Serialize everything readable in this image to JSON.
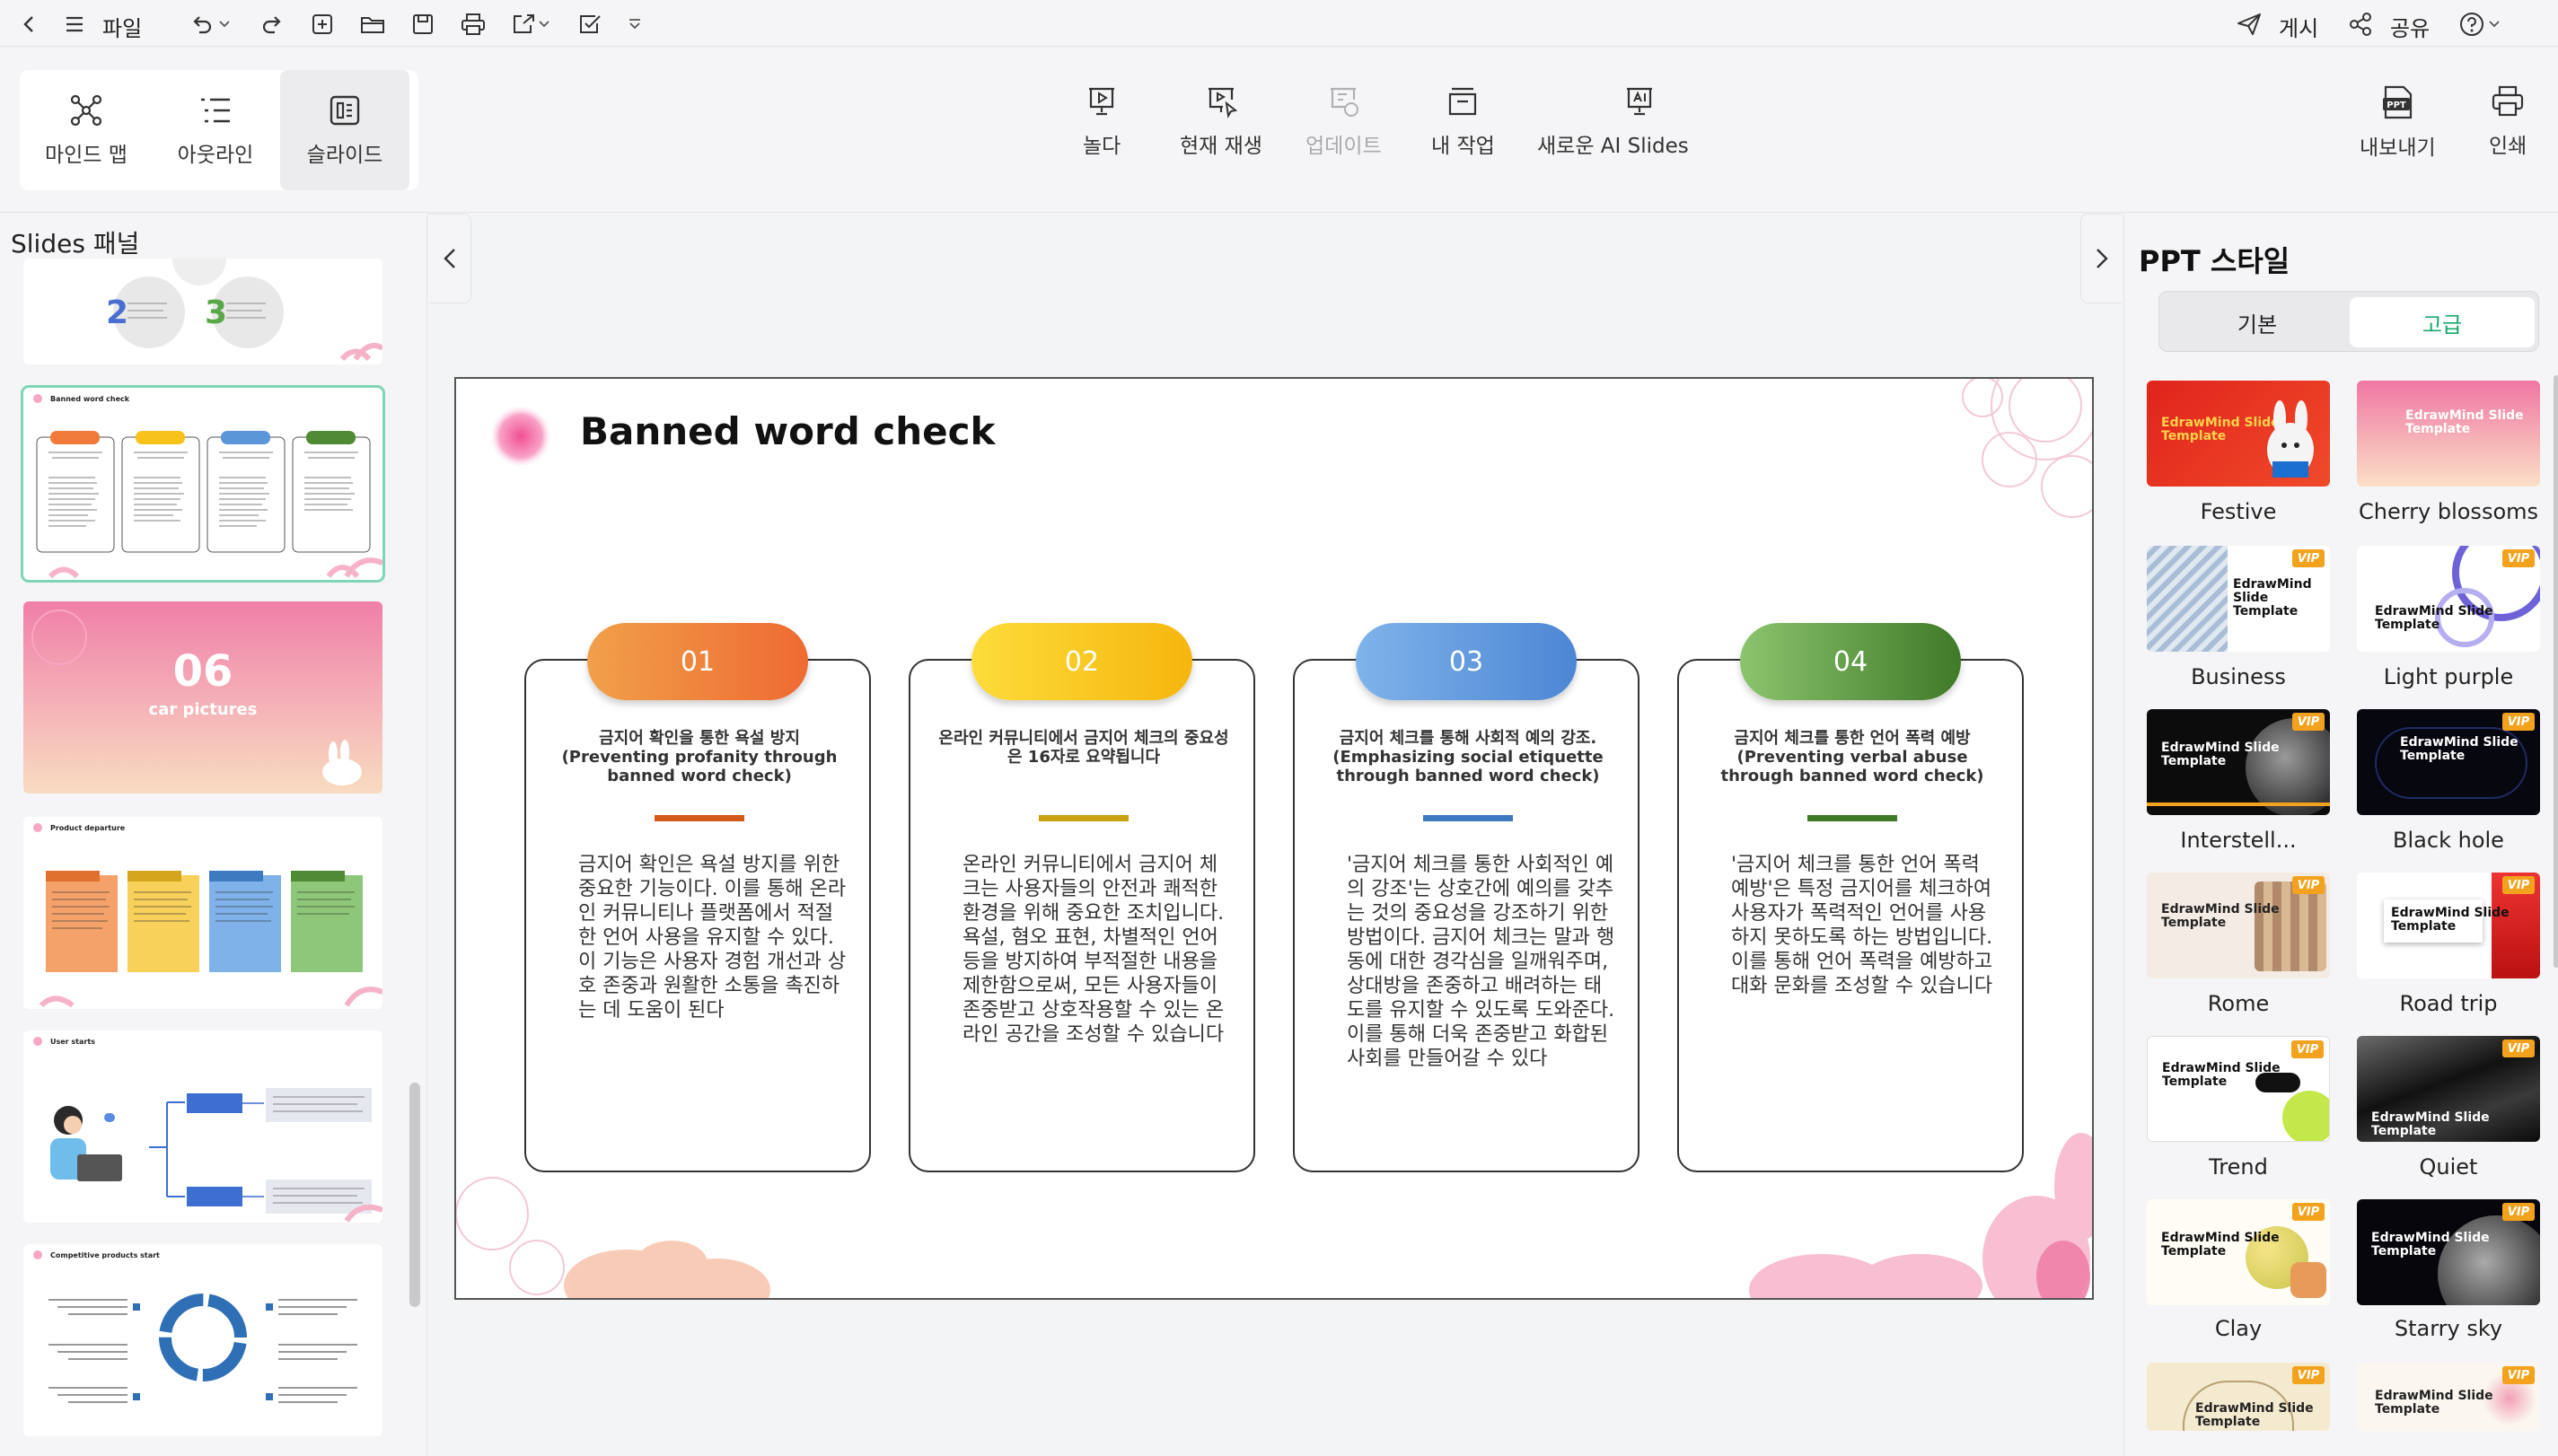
{
  "menubar": {
    "file_label": "파일",
    "publish_label": "게시",
    "share_label": "공유"
  },
  "views": [
    {
      "label": "마인드 맵",
      "icon": "mindmap-icon"
    },
    {
      "label": "아웃라인",
      "icon": "outline-icon"
    },
    {
      "label": "슬라이드",
      "icon": "slide-icon"
    }
  ],
  "ribbon": {
    "play_label": "놀다",
    "play_current_label": "현재 재생",
    "update_label": "업데이트",
    "my_work_label": "내 작업",
    "new_ai_label": "새로운 AI Slides",
    "export_label": "내보내기",
    "print_label": "인쇄"
  },
  "left_panel": {
    "title": "Slides 패널",
    "thumbs": [
      {
        "title": "Banned word check"
      },
      {
        "number": "06",
        "subtitle": "car pictures"
      },
      {
        "title": "Product departure"
      },
      {
        "title": "User starts"
      },
      {
        "title": "Competitive products start"
      }
    ]
  },
  "slide": {
    "title": "Banned word check",
    "cards": [
      {
        "num": "01",
        "color": "#f07a3a",
        "bar_color": "#d35a1a",
        "heading": "금지어 확인을 통한 욕설 방지 (Preventing profanity through banned word check)",
        "body": "금지어 확인은 욕설 방지를 위한 중요한 기능이다. 이를 통해 온라인 커뮤니티나 플랫폼에서 적절한 언어 사용을 유지할 수 있다. 이 기능은 사용자 경험 개선과 상호 존중과 원활한 소통을 촉진하는 데 도움이 된다"
      },
      {
        "num": "02",
        "color": "#f7c21a",
        "bar_color": "#c8a010",
        "heading": "온라인 커뮤니티에서 금지어 체크의 중요성은 16자로 요약됩니다",
        "body": "온라인 커뮤니티에서 금지어 체크는 사용자들의 안전과 쾌적한 환경을 위해 중요한 조치입니다. 욕설, 혐오 표현, 차별적인 언어 등을 방지하여 부적절한 내용을 제한함으로써, 모든 사용자들이 존중받고 상호작용할 수 있는 온라인 공간을 조성할 수 있습니다"
      },
      {
        "num": "03",
        "color": "#5b96d8",
        "bar_color": "#3d7ac0",
        "heading": "금지어 체크를 통해 사회적 예의 강조. (Emphasizing social etiquette through banned word check)",
        "body": "'금지어 체크를 통한 사회적인 예의 강조'는 상호간에 예의를 갖추는 것의 중요성을 강조하기 위한 방법이다. 금지어 체크는 말과 행동에 대한 경각심을 일깨워주며, 상대방을 존중하고 배려하는 태도를 유지할 수 있도록 도와준다. 이를 통해 더욱 존중받고 화합된 사회를 만들어갈 수 있다"
      },
      {
        "num": "04",
        "color": "#4f8a35",
        "bar_color": "#3f7a28",
        "heading": "금지어 체크를 통한 언어 폭력 예방 (Preventing verbal abuse through banned word check)",
        "body": "'금지어 체크를 통한 언어 폭력 예방'은 특정 금지어를 체크하여 사용자가 폭력적인 언어를 사용하지 못하도록 하는 방법입니다. 이를 통해 언어 폭력을 예방하고 대화 문화를 조성할 수 있습니다"
      }
    ]
  },
  "right_panel": {
    "title": "PPT 스타일",
    "tab_basic": "기본",
    "tab_advanced": "고급",
    "template_label": "EdrawMind Slide Template",
    "vip_label": "VIP",
    "templates": [
      {
        "name": "Festive",
        "vip": false
      },
      {
        "name": "Cherry blossoms",
        "vip": false
      },
      {
        "name": "Business",
        "vip": true
      },
      {
        "name": "Light purple",
        "vip": true
      },
      {
        "name": "Interstell...",
        "vip": true
      },
      {
        "name": "Black hole",
        "vip": true
      },
      {
        "name": "Rome",
        "vip": true
      },
      {
        "name": "Road trip",
        "vip": true
      },
      {
        "name": "Trend",
        "vip": true
      },
      {
        "name": "Quiet",
        "vip": true
      },
      {
        "name": "Clay",
        "vip": true
      },
      {
        "name": "Starry sky",
        "vip": true
      },
      {
        "name": "",
        "vip": true
      },
      {
        "name": "",
        "vip": true
      }
    ]
  }
}
